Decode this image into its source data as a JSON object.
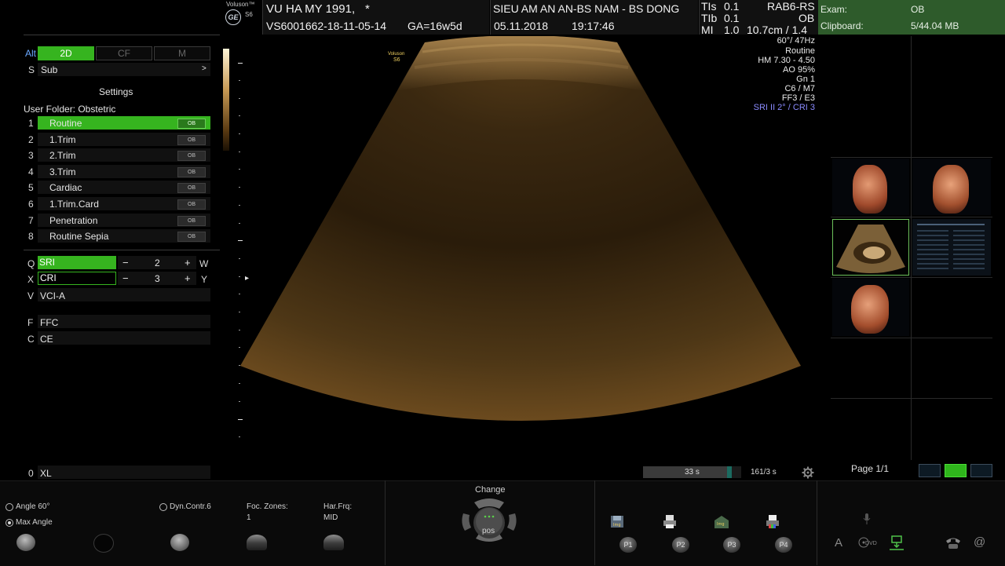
{
  "header": {
    "brand_top": "Voluson™",
    "brand_model": "S6",
    "ge_logo": "GE",
    "patient": "VU HA MY 1991,",
    "patient_flag": "*",
    "patient_id": "VS6001662-18-11-05-14",
    "ga": "GA=16w5d",
    "institution": "SIEU AM AN AN-BS NAM - BS DONG",
    "date": "05.11.2018",
    "time": "19:17:46",
    "tis_label": "TIs",
    "tis_value": "0.1",
    "tib_label": "TIb",
    "tib_value": "0.1",
    "mi_label": "MI",
    "mi_value": "1.0",
    "probe": "RAB6-RS",
    "app": "OB",
    "depth": "10.7cm / 1.4"
  },
  "exam_panel": {
    "exam_label": "Exam:",
    "exam_value": "OB",
    "clipboard_label": "Clipboard:",
    "clipboard_value": "5/44.04 MB"
  },
  "left_panel": {
    "alt_key": "Alt",
    "modes": [
      "2D",
      "CF",
      "M"
    ],
    "sub_key": "S",
    "sub_label": "Sub",
    "sub_arrow": ">",
    "settings_title": "Settings",
    "user_folder": "User Folder: Obstetric",
    "presets": [
      {
        "num": "1",
        "label": "Routine",
        "badge": "OB"
      },
      {
        "num": "2",
        "label": "1.Trim",
        "badge": "OB"
      },
      {
        "num": "3",
        "label": "2.Trim",
        "badge": "OB"
      },
      {
        "num": "4",
        "label": "3.Trim",
        "badge": "OB"
      },
      {
        "num": "5",
        "label": "Cardiac",
        "badge": "OB"
      },
      {
        "num": "6",
        "label": "1.Trim.Card",
        "badge": "OB"
      },
      {
        "num": "7",
        "label": "Penetration",
        "badge": "OB"
      },
      {
        "num": "8",
        "label": "Routine Sepia",
        "badge": "OB"
      }
    ],
    "sri": {
      "key_left": "Q",
      "label": "SRI",
      "minus": "−",
      "value": "2",
      "plus": "+",
      "key_right": "W"
    },
    "cri": {
      "key_left": "X",
      "label": "CRI",
      "minus": "−",
      "value": "3",
      "plus": "+",
      "key_right": "Y"
    },
    "vci": {
      "key": "V",
      "label": "VCI-A"
    },
    "ffc": {
      "key": "F",
      "label": "FFC"
    },
    "ce": {
      "key": "C",
      "label": "CE"
    },
    "xl": {
      "key": "0",
      "label": "XL"
    }
  },
  "image": {
    "overlay_brand": "Voluson",
    "overlay_model": "S6",
    "cursor_marker": "▸"
  },
  "info_right": {
    "angle_fps": "60°/ 47Hz",
    "preset": "Routine",
    "hm": "HM  7.30 - 4.50",
    "ao": "AO 95%",
    "gn": "Gn   1",
    "c_m": "C6 / M7",
    "ff_e": "FF3 / E3",
    "sri_cri": "SRI II 2° / CRI 3"
  },
  "cine": {
    "bar_label": "33 s",
    "bar_fill": 0.9,
    "counter": "161/3 s",
    "settings_icon": "gear-icon"
  },
  "thumbs": {
    "page": "Page 1/1"
  },
  "bottom": {
    "angle_label": "Angle 60°",
    "max_angle_label": "Max Angle",
    "dyn_label": "Dyn.Contr.6",
    "foc_label": "Foc. Zones:",
    "foc_value": "1",
    "har_label": "Har.Frq:",
    "har_value": "MID",
    "change_label": "Change",
    "pos_label": "pos",
    "p_buttons": [
      "P1",
      "P2",
      "P3",
      "P4"
    ],
    "img_icon_label": "Img",
    "dvd_label": "DVD",
    "a_label": "A",
    "at_label": "@"
  },
  "colors": {
    "accent_green": "#36b41f",
    "exam_green": "#2e5b2b",
    "sri_text": "#8b8bff",
    "sepia": "#6b4a1e"
  }
}
